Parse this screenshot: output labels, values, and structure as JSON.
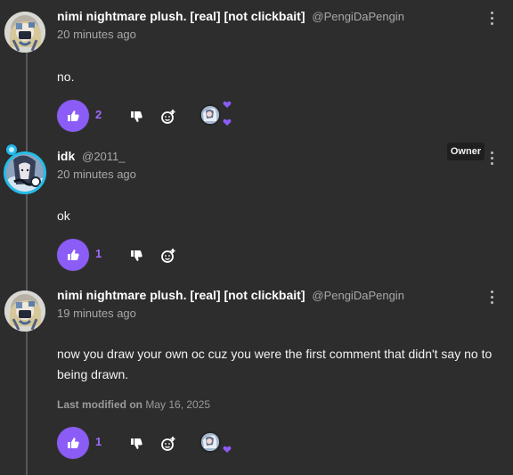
{
  "comments": [
    {
      "author": {
        "name": "nimi nightmare plush. [real] [not clickbait]",
        "handle": "@PengiDaPengin",
        "avatar": "plush-avatar",
        "is_owner": false
      },
      "timestamp": "20 minutes ago",
      "text": "no.",
      "likes": "2",
      "actions": {
        "like_icon": "thumbs-up-icon",
        "dislike_icon": "thumbs-down-icon",
        "react_icon": "add-reaction-icon",
        "reaction_avatar": "owner-avatar"
      }
    },
    {
      "author": {
        "name": "idk",
        "handle": "@2011_",
        "avatar": "anime-avatar",
        "is_owner": true,
        "badge": "Owner"
      },
      "timestamp": "20 minutes ago",
      "text": "ok",
      "likes": "1",
      "actions": {
        "like_icon": "thumbs-up-icon",
        "dislike_icon": "thumbs-down-icon",
        "react_icon": "add-reaction-icon"
      }
    },
    {
      "author": {
        "name": "nimi nightmare plush. [real] [not clickbait]",
        "handle": "@PengiDaPengin",
        "avatar": "plush-avatar",
        "is_owner": false
      },
      "timestamp": "19 minutes ago",
      "text": "now you draw your own oc cuz you were the first comment that didn't say no to being drawn.",
      "modified": {
        "label": "Last modified on",
        "date": "May 16, 2025"
      },
      "likes": "1",
      "actions": {
        "like_icon": "thumbs-up-icon",
        "dislike_icon": "thumbs-down-icon",
        "react_icon": "add-reaction-icon",
        "reaction_avatar": "owner-avatar"
      }
    }
  ],
  "colors": {
    "background": "#2d2d2d",
    "accent": "#8b5cf6",
    "accent_text": "#9b6bff",
    "owner_ring": "#25bde9",
    "muted_text": "#a8a8a8",
    "thread_line": "#585858"
  },
  "icons": {
    "more": "vertical-dots-icon",
    "like": "thumbs-up-icon",
    "dislike": "thumbs-down-icon",
    "react": "add-reaction-icon",
    "heart": "heart-icon"
  }
}
